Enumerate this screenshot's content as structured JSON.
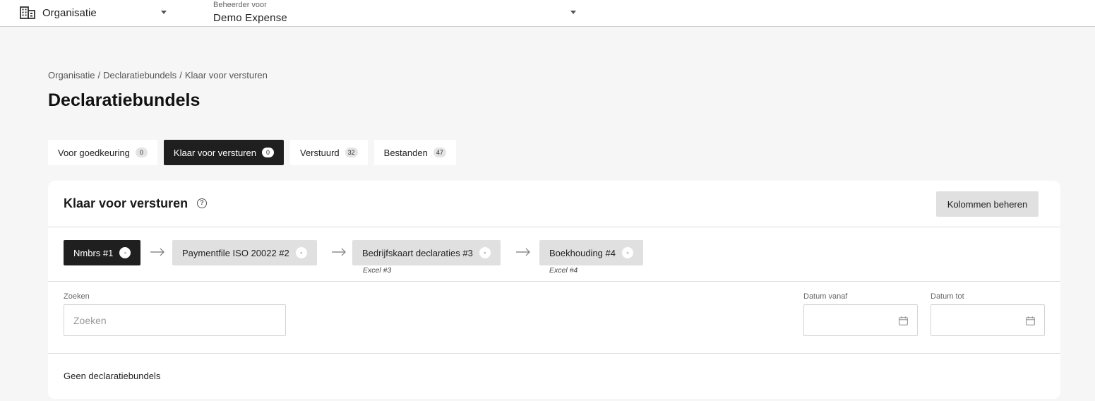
{
  "topbar": {
    "org_label": "Organisatie",
    "admin_small": "Beheerder voor",
    "admin_value": "Demo Expense"
  },
  "breadcrumb": [
    "Organisatie",
    "Declaratiebundels",
    "Klaar voor versturen"
  ],
  "page_title": "Declaratiebundels",
  "tabs": [
    {
      "label": "Voor goedkeuring",
      "count": "0"
    },
    {
      "label": "Klaar voor versturen",
      "count": "0"
    },
    {
      "label": "Verstuurd",
      "count": "32"
    },
    {
      "label": "Bestanden",
      "count": "47"
    }
  ],
  "card": {
    "title": "Klaar voor versturen",
    "help_glyph": "?",
    "manage_button": "Kolommen beheren"
  },
  "steps": [
    {
      "label": "Nmbrs #1",
      "badge": "-",
      "sub": ""
    },
    {
      "label": "Paymentfile ISO 20022 #2",
      "badge": "-",
      "sub": ""
    },
    {
      "label": "Bedrijfskaart declaraties #3",
      "badge": "-",
      "sub": "Excel #3"
    },
    {
      "label": "Boekhouding #4",
      "badge": "-",
      "sub": "Excel #4"
    }
  ],
  "filters": {
    "search_label": "Zoeken",
    "search_placeholder": "Zoeken",
    "from_label": "Datum vanaf",
    "to_label": "Datum tot"
  },
  "empty_message": "Geen declaratiebundels",
  "colors": {
    "accent_dark": "#1f1f1f",
    "background": "#f6f6f6"
  }
}
